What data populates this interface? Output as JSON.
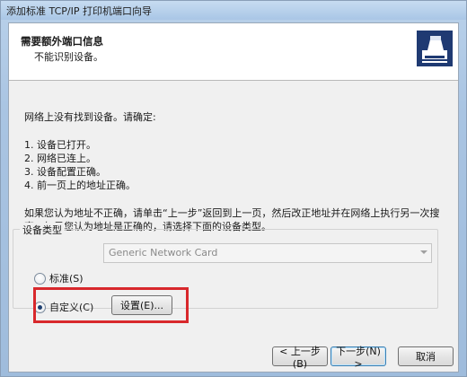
{
  "window": {
    "title": "添加标准 TCP/IP 打印机端口向导"
  },
  "header": {
    "title": "需要额外端口信息",
    "subtitle": "不能识别设备。"
  },
  "body": {
    "intro": "网络上没有找到设备。请确定:",
    "checks": [
      "1.  设备已打开。",
      "2.  网络已连上。",
      "3.  设备配置正确。",
      "4.  前一页上的地址正确。"
    ],
    "paragraph_line1": "如果您认为地址不正确，请单击“上一步”返回到上一页，然后改正地址并在网络上执行另一次搜",
    "paragraph_line2": "索。如果您认为地址是正确的，请选择下面的设备类型。"
  },
  "device_type": {
    "group_label": "设备类型",
    "standard_label": "标准(S)",
    "standard_selected": false,
    "standard_value": "Generic Network Card",
    "custom_label": "自定义(C)",
    "custom_selected": true,
    "settings_button": "设置(E)..."
  },
  "footer": {
    "back_button": "< 上一步(B)",
    "next_button": "下一步(N) >",
    "cancel_button": "取消"
  },
  "colors": {
    "highlight": "#d8282c",
    "window_frame": "#a9c4e2"
  }
}
